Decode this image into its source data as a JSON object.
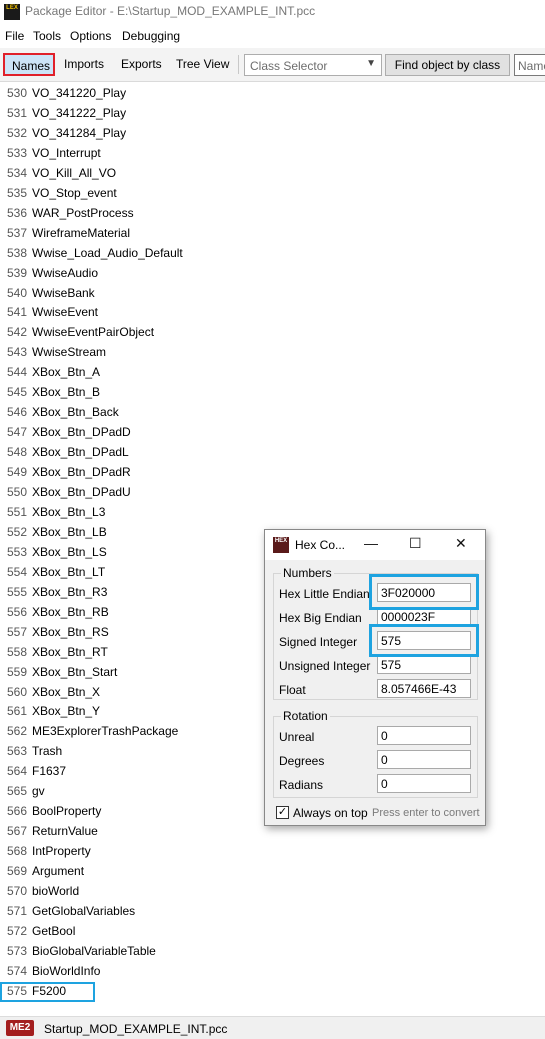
{
  "window": {
    "title": "Package Editor - E:\\Startup_MOD_EXAMPLE_INT.pcc",
    "app_icon": "LEX"
  },
  "menu": [
    "File",
    "Tools",
    "Options",
    "Debugging"
  ],
  "toolbar": {
    "tabs": [
      "Names",
      "Imports",
      "Exports",
      "Tree View"
    ],
    "class_selector_placeholder": "Class Selector",
    "find_button": "Find object by class",
    "search_placeholder": "Name"
  },
  "names_list": [
    {
      "i": "530",
      "n": "VO_341220_Play"
    },
    {
      "i": "531",
      "n": "VO_341222_Play"
    },
    {
      "i": "532",
      "n": "VO_341284_Play"
    },
    {
      "i": "533",
      "n": "VO_Interrupt"
    },
    {
      "i": "534",
      "n": "VO_Kill_All_VO"
    },
    {
      "i": "535",
      "n": "VO_Stop_event"
    },
    {
      "i": "536",
      "n": "WAR_PostProcess"
    },
    {
      "i": "537",
      "n": "WireframeMaterial"
    },
    {
      "i": "538",
      "n": "Wwise_Load_Audio_Default"
    },
    {
      "i": "539",
      "n": "WwiseAudio"
    },
    {
      "i": "540",
      "n": "WwiseBank"
    },
    {
      "i": "541",
      "n": "WwiseEvent"
    },
    {
      "i": "542",
      "n": "WwiseEventPairObject"
    },
    {
      "i": "543",
      "n": "WwiseStream"
    },
    {
      "i": "544",
      "n": "XBox_Btn_A"
    },
    {
      "i": "545",
      "n": "XBox_Btn_B"
    },
    {
      "i": "546",
      "n": "XBox_Btn_Back"
    },
    {
      "i": "547",
      "n": "XBox_Btn_DPadD"
    },
    {
      "i": "548",
      "n": "XBox_Btn_DPadL"
    },
    {
      "i": "549",
      "n": "XBox_Btn_DPadR"
    },
    {
      "i": "550",
      "n": "XBox_Btn_DPadU"
    },
    {
      "i": "551",
      "n": "XBox_Btn_L3"
    },
    {
      "i": "552",
      "n": "XBox_Btn_LB"
    },
    {
      "i": "553",
      "n": "XBox_Btn_LS"
    },
    {
      "i": "554",
      "n": "XBox_Btn_LT"
    },
    {
      "i": "555",
      "n": "XBox_Btn_R3"
    },
    {
      "i": "556",
      "n": "XBox_Btn_RB"
    },
    {
      "i": "557",
      "n": "XBox_Btn_RS"
    },
    {
      "i": "558",
      "n": "XBox_Btn_RT"
    },
    {
      "i": "559",
      "n": "XBox_Btn_Start"
    },
    {
      "i": "560",
      "n": "XBox_Btn_X"
    },
    {
      "i": "561",
      "n": "XBox_Btn_Y"
    },
    {
      "i": "562",
      "n": "ME3ExplorerTrashPackage"
    },
    {
      "i": "563",
      "n": "Trash"
    },
    {
      "i": "564",
      "n": "F1637"
    },
    {
      "i": "565",
      "n": "gv"
    },
    {
      "i": "566",
      "n": "BoolProperty"
    },
    {
      "i": "567",
      "n": "ReturnValue"
    },
    {
      "i": "568",
      "n": "IntProperty"
    },
    {
      "i": "569",
      "n": "Argument"
    },
    {
      "i": "570",
      "n": "bioWorld"
    },
    {
      "i": "571",
      "n": "GetGlobalVariables"
    },
    {
      "i": "572",
      "n": "GetBool"
    },
    {
      "i": "573",
      "n": "BioGlobalVariableTable"
    },
    {
      "i": "574",
      "n": "BioWorldInfo"
    },
    {
      "i": "575",
      "n": "F5200"
    }
  ],
  "selected_row": "575",
  "status": {
    "game_badge": "ME2",
    "file": "Startup_MOD_EXAMPLE_INT.pcc"
  },
  "hex_dialog": {
    "title": "Hex Co...",
    "icon": "HEX",
    "controls": {
      "minimize": "—",
      "maximize": "☐",
      "close": "✕"
    },
    "numbers_label": "Numbers",
    "numbers": [
      {
        "label": "Hex Little Endian",
        "value": "3F020000"
      },
      {
        "label": "Hex Big Endian",
        "value": "0000023F"
      },
      {
        "label": "Signed Integer",
        "value": "575"
      },
      {
        "label": "Unsigned Integer",
        "value": "575"
      },
      {
        "label": "Float",
        "value": "8.057466E-43"
      }
    ],
    "rotation_label": "Rotation",
    "rotation": [
      {
        "label": "Unreal",
        "value": "0"
      },
      {
        "label": "Degrees",
        "value": "0"
      },
      {
        "label": "Radians",
        "value": "0"
      }
    ],
    "always_on_top_label": "Always on top",
    "always_on_top_checked": true,
    "hint": "Press enter to convert"
  },
  "colors": {
    "highlight_red": "#e0202a",
    "highlight_blue": "#1ea3e0",
    "me2_badge": "#a31e1e"
  }
}
